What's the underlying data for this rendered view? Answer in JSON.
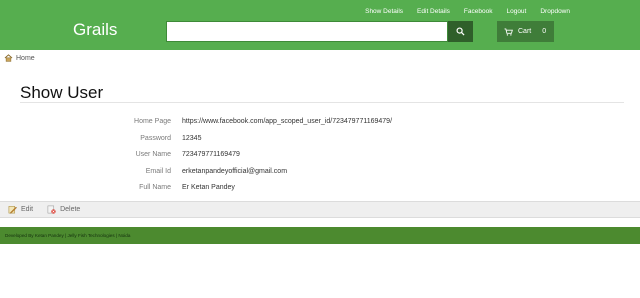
{
  "colors": {
    "header_bg": "#56ae4f",
    "search_button": "#2f5f2a",
    "cart_bg": "#3f7d39",
    "footer_bg": "#4c8a2f"
  },
  "nav": {
    "links": [
      "Show Details",
      "Edit Details",
      "Facebook",
      "Logout",
      "Dropdown"
    ]
  },
  "brand": "Grails",
  "search": {
    "placeholder": "",
    "value": "",
    "icon": "search-icon"
  },
  "cart": {
    "label": "Cart",
    "count": "0",
    "icon": "cart-icon"
  },
  "breadcrumb": {
    "home_label": "Home",
    "icon": "home-icon"
  },
  "page_title": "Show User",
  "fields": [
    {
      "label": "Home Page",
      "value": "https://www.facebook.com/app_scoped_user_id/723479771169479/"
    },
    {
      "label": "Password",
      "value": "12345"
    },
    {
      "label": "User Name",
      "value": "723479771169479"
    },
    {
      "label": "Email Id",
      "value": "erketanpandeyofficial@gmail.com"
    },
    {
      "label": "Full Name",
      "value": "Er Ketan Pandey"
    }
  ],
  "actions": {
    "edit_label": "Edit",
    "delete_label": "Delete"
  },
  "footer": "Developed By Ketan Pandey | Jelly Fish Technologies | Noida"
}
